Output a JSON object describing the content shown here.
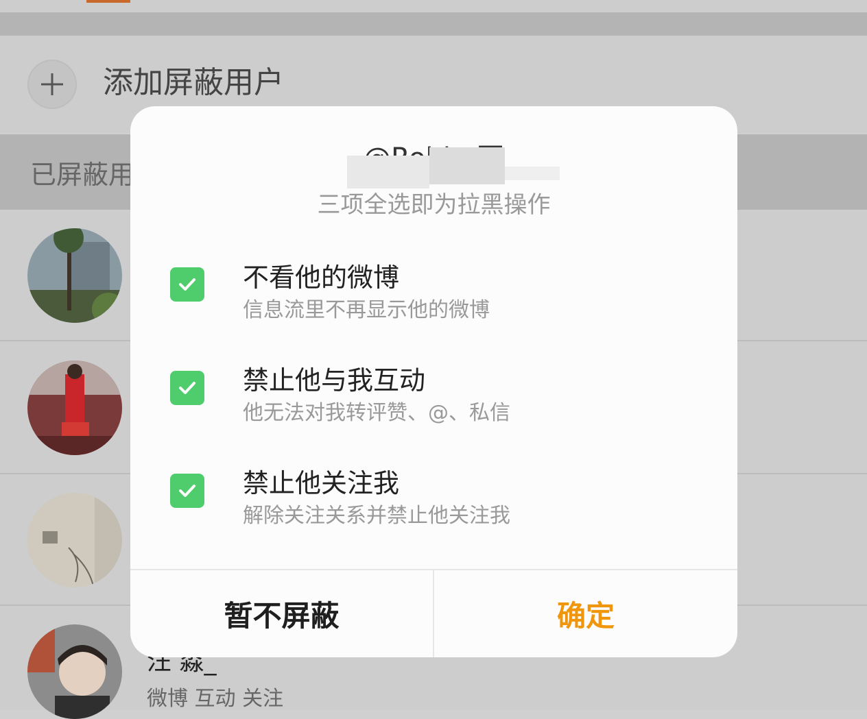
{
  "background": {
    "add_label": "添加屏蔽用户",
    "section_label": "已屏蔽用户",
    "rows": [
      {
        "name": "",
        "meta": ""
      },
      {
        "name": "",
        "meta": ""
      },
      {
        "name": "",
        "meta": ""
      },
      {
        "name": "汪  淼_",
        "meta": "微博 互动 关注"
      }
    ]
  },
  "modal": {
    "title": "@Robin  哥",
    "subtitle": "三项全选即为拉黑操作",
    "options": [
      {
        "title": "不看他的微博",
        "desc": "信息流里不再显示他的微博",
        "checked": true
      },
      {
        "title": "禁止他与我互动",
        "desc": "他无法对我转评赞、@、私信",
        "checked": true
      },
      {
        "title": "禁止他关注我",
        "desc": "解除关注关系并禁止他关注我",
        "checked": true
      }
    ],
    "cancel_label": "暂不屏蔽",
    "confirm_label": "确定"
  },
  "colors": {
    "accent": "#f0960c",
    "check": "#4fcd6c",
    "overlay_bg": "#cdcdcd"
  }
}
